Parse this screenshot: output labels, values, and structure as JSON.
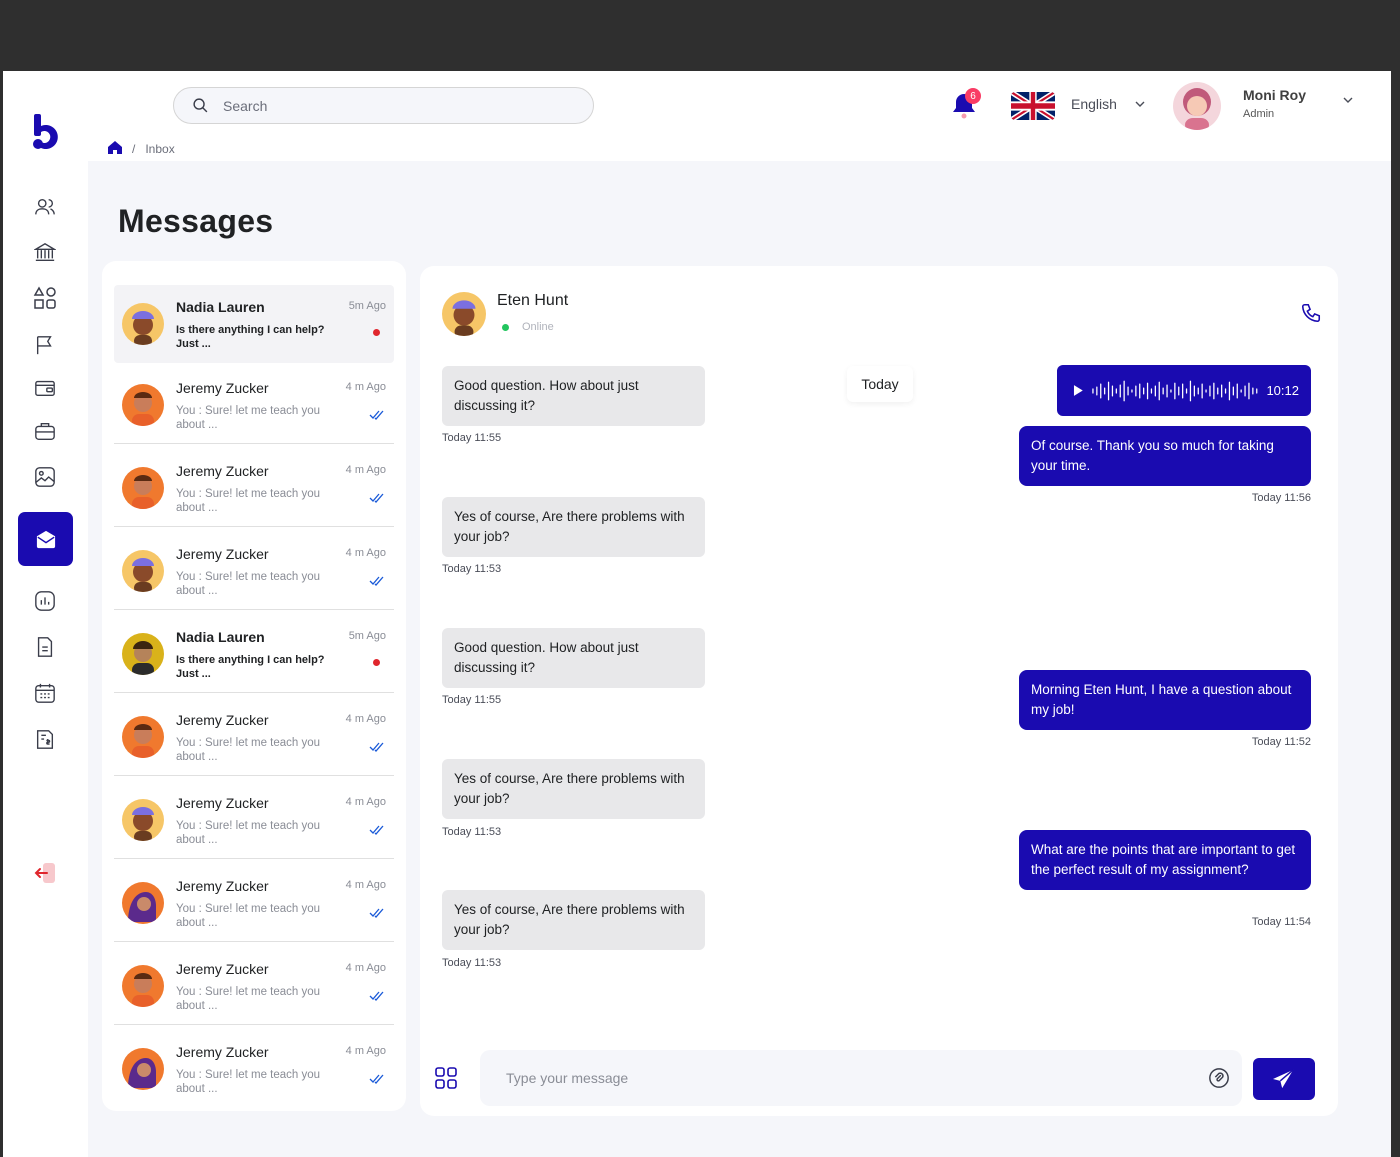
{
  "search": {
    "placeholder": "Search"
  },
  "breadcrumb": {
    "current": "Inbox",
    "separator": "/"
  },
  "notifications": {
    "count": "6"
  },
  "language": {
    "label": "English",
    "flag": "uk-flag"
  },
  "user": {
    "name": "Moni Roy",
    "role": "Admin"
  },
  "page": {
    "title": "Messages"
  },
  "conversations": [
    {
      "name": "Nadia Lauren",
      "time": "5m Ago",
      "message": "Is there anything I can help? Just ...",
      "unread": true,
      "avatar": "avatar-cap"
    },
    {
      "name": "Jeremy Zucker",
      "time": "4 m Ago",
      "message": "You : Sure! let me teach you about ...",
      "unread": false,
      "avatar": "avatar-orange"
    },
    {
      "name": "Jeremy Zucker",
      "time": "4 m Ago",
      "message": "You : Sure! let me teach you about ...",
      "unread": false,
      "avatar": "avatar-orange"
    },
    {
      "name": "Jeremy Zucker",
      "time": "4 m Ago",
      "message": "You : Sure! let me teach you about ...",
      "unread": false,
      "avatar": "avatar-cap"
    },
    {
      "name": "Nadia Lauren",
      "time": "5m Ago",
      "message": "Is there anything I can help? Just ...",
      "unread": true,
      "avatar": "avatar-yellow"
    },
    {
      "name": "Jeremy Zucker",
      "time": "4 m Ago",
      "message": "You : Sure! let me teach you about ...",
      "unread": false,
      "avatar": "avatar-orange"
    },
    {
      "name": "Jeremy Zucker",
      "time": "4 m Ago",
      "message": "You : Sure! let me teach you about ...",
      "unread": false,
      "avatar": "avatar-cap"
    },
    {
      "name": "Jeremy Zucker",
      "time": "4 m Ago",
      "message": "You : Sure! let me teach you about ...",
      "unread": false,
      "avatar": "avatar-purple"
    },
    {
      "name": "Jeremy Zucker",
      "time": "4 m Ago",
      "message": "You : Sure! let me teach you about ...",
      "unread": false,
      "avatar": "avatar-orange"
    },
    {
      "name": "Jeremy Zucker",
      "time": "4 m Ago",
      "message": "You : Sure! let me teach you about ...",
      "unread": false,
      "avatar": "avatar-purple"
    }
  ],
  "chat": {
    "contact": {
      "name": "Eten Hunt",
      "status": "Online"
    },
    "day_label": "Today",
    "voice": {
      "duration": "10:12"
    },
    "incoming": [
      {
        "text": "Good question. How about just discussing it?",
        "time": "Today 11:55"
      },
      {
        "text": "Yes of course, Are there problems with your job?",
        "time": "Today 11:53"
      },
      {
        "text": "Good question. How about just discussing it?",
        "time": "Today 11:55"
      },
      {
        "text": "Yes of course, Are there problems with your job?",
        "time": "Today 11:53"
      },
      {
        "text": "Yes of course, Are there problems with your job?",
        "time": "Today 11:53"
      }
    ],
    "outgoing": [
      {
        "text": "Of course. Thank you so much for taking your time.",
        "time": "Today 11:56"
      },
      {
        "text": "Morning Eten Hunt, I have a question about my job!",
        "time": "Today 11:52"
      },
      {
        "text": "What are the points that are important to get the perfect result of my assignment?",
        "time": "Today 11:54"
      }
    ],
    "composer_placeholder": "Type your message"
  },
  "colors": {
    "accent": "#1a0bb0",
    "badge": "#f93c65",
    "online": "#22c55e",
    "unread_dot": "#e0262d"
  },
  "sidebar": {
    "icons": [
      "users-icon",
      "bank-icon",
      "shapes-icon",
      "flag-icon",
      "wallet-icon",
      "briefcase-icon",
      "image-icon",
      "inbox-icon",
      "chart-icon",
      "document-icon",
      "calendar-icon",
      "invoice-icon",
      "logout-icon"
    ],
    "active": "inbox-icon"
  }
}
